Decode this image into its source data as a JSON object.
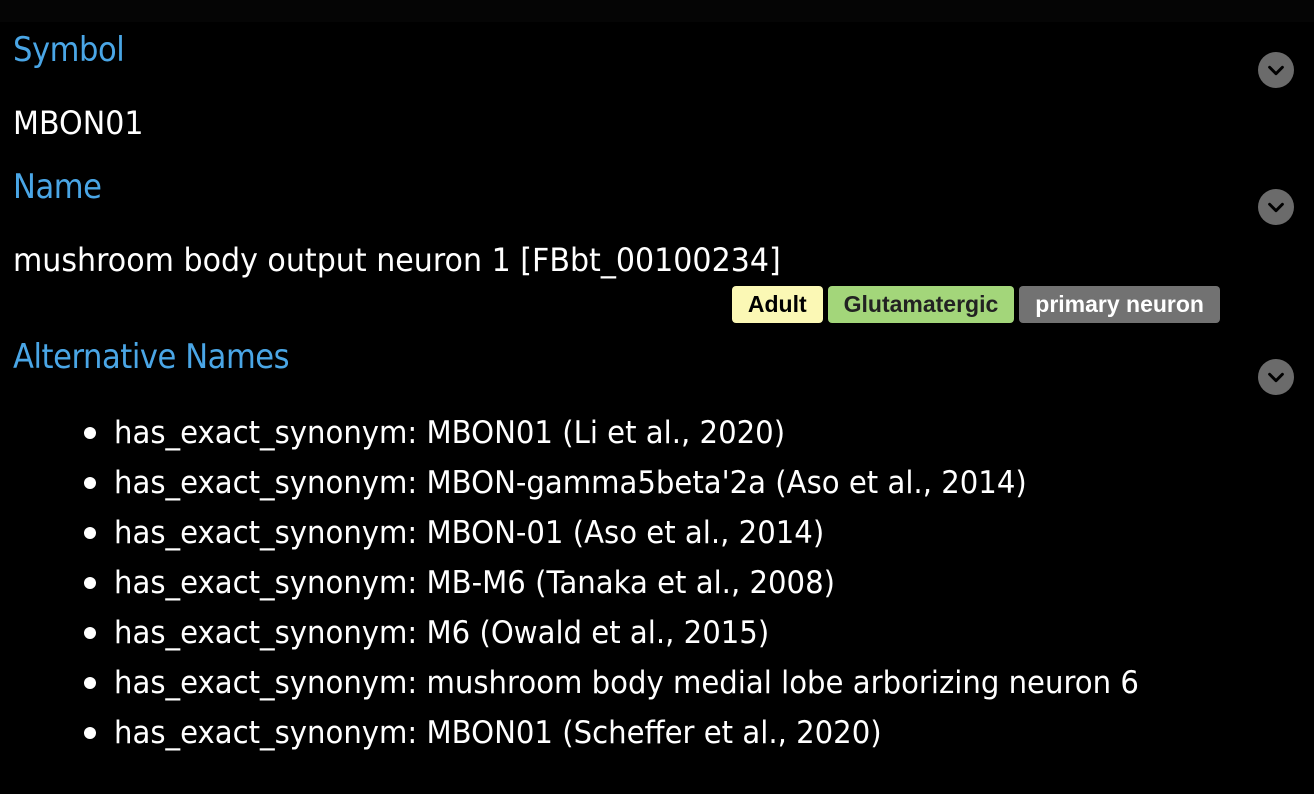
{
  "symbol": {
    "title": "Symbol",
    "value": "MBON01"
  },
  "name": {
    "title": "Name",
    "value": "mushroom body output neuron 1 [FBbt_00100234]",
    "tags": [
      "Adult",
      "Glutamatergic",
      "primary neuron"
    ]
  },
  "alternative_names": {
    "title": "Alternative Names",
    "items": [
      "has_exact_synonym: MBON01 (Li et al., 2020)",
      "has_exact_synonym: MBON-gamma5beta'2a (Aso et al., 2014)",
      "has_exact_synonym: MBON-01 (Aso et al., 2014)",
      "has_exact_synonym: MB-M6 (Tanaka et al., 2008)",
      "has_exact_synonym: M6 (Owald et al., 2015)",
      "has_exact_synonym: mushroom body medial lobe arborizing neuron 6",
      "has_exact_synonym: MBON01 (Scheffer et al., 2020)"
    ]
  },
  "icons": {
    "toggle": "chevron-down-icon"
  },
  "colors": {
    "background": "#000000",
    "section_title": "#4aa6e6",
    "tag_adult": "#fbf8b5",
    "tag_glutamatergic": "#a3d67a",
    "tag_primary_neuron": "#727272",
    "toggle_button": "#6b6b6b"
  }
}
